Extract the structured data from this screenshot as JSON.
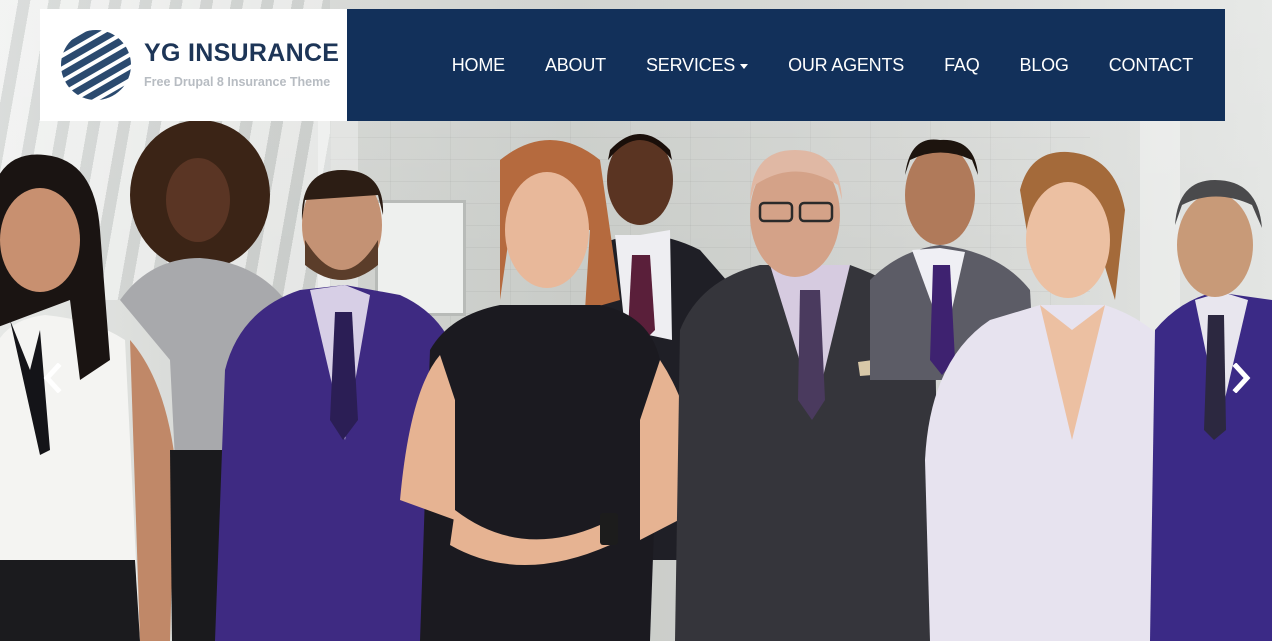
{
  "brand": {
    "title": "YG INSURANCE",
    "subtitle": "Free Drupal 8 Insurance Theme",
    "logo_icon": "striped-globe-logo",
    "color": "#2b4a6f"
  },
  "nav": {
    "items": [
      {
        "label": "HOME"
      },
      {
        "label": "ABOUT"
      },
      {
        "label": "SERVICES",
        "has_dropdown": true
      },
      {
        "label": "OUR AGENTS"
      },
      {
        "label": "FAQ"
      },
      {
        "label": "BLOG"
      },
      {
        "label": "CONTACT"
      }
    ],
    "background": "#12305a",
    "text_color": "#ffffff"
  },
  "slider": {
    "prev_icon": "chevron-left-icon",
    "next_icon": "chevron-right-icon",
    "image": "group-of-business-people-photo"
  }
}
